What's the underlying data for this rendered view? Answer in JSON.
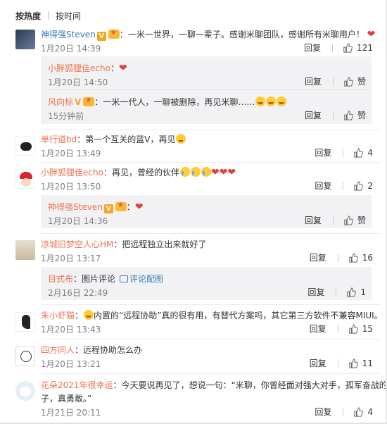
{
  "sort": {
    "hot": "按热度",
    "time": "按时间"
  },
  "actions": {
    "reply": "回复",
    "like": "赞"
  },
  "comments": [
    {
      "user": "神得强Steven",
      "sep": "：",
      "text": "一米一世界，一聊一辈子。感谢米聊团队，感谢所有米聊用户！",
      "time": "1月20日 14:39",
      "likes": "121"
    },
    {
      "user": "单行道bd",
      "sep": "：",
      "text": "第一个互关的蓝V，再见",
      "time": "1月20日 13:49",
      "likes": "4"
    },
    {
      "user": "小胖狐狸佳echo",
      "sep": "：",
      "text": "再见，曾经的伙伴",
      "time": "1月20日 13:50",
      "likes": "2"
    },
    {
      "user": "凉城旧梦空人心HM",
      "sep": "：",
      "text": "把远程独立出来就好了",
      "time": "1月20日 13:17",
      "likes": "16"
    },
    {
      "user": "朱小虾猫",
      "sep": "：",
      "text": "内置的“远程协助”真的很有用，有替代方案吗，其它第三方软件不兼容MIUI。",
      "time": "1月20日 13:43",
      "likes": "15"
    },
    {
      "user": "四方同人",
      "sep": "：",
      "text": "远程协助怎么办",
      "time": "1月20日 13:21",
      "likes": "11"
    },
    {
      "user": "花朵2021年很幸运",
      "sep": "：",
      "text": "今天要说再见了，想说一句：“米聊，你曾经面对强大对手，孤军奋战的样",
      "text2": "子，真勇敢。”",
      "time": "1月21日 20:11",
      "likes": "4"
    }
  ],
  "replies": [
    {
      "user": "小胖狐狸佳echo",
      "sep": "：",
      "text": "",
      "time": "1月20日 14:50"
    },
    {
      "user": "风向标",
      "sep": "：",
      "text": "一米一代人，一聊被删除，再见米聊……",
      "time": "15分钟前"
    },
    {
      "user": "神得强Steven",
      "sep": "：",
      "text": "",
      "time": "1月20日 14:36"
    },
    {
      "user": "目式布",
      "sep": "：",
      "text": "图片评论",
      "link": "评论配图",
      "time": "2月16日 22:49",
      "likes": "1"
    }
  ],
  "colors": {
    "username": "#eb7350",
    "link": "#3a7ab8",
    "meta": "#808080",
    "replyBg": "#f2f2f5"
  }
}
